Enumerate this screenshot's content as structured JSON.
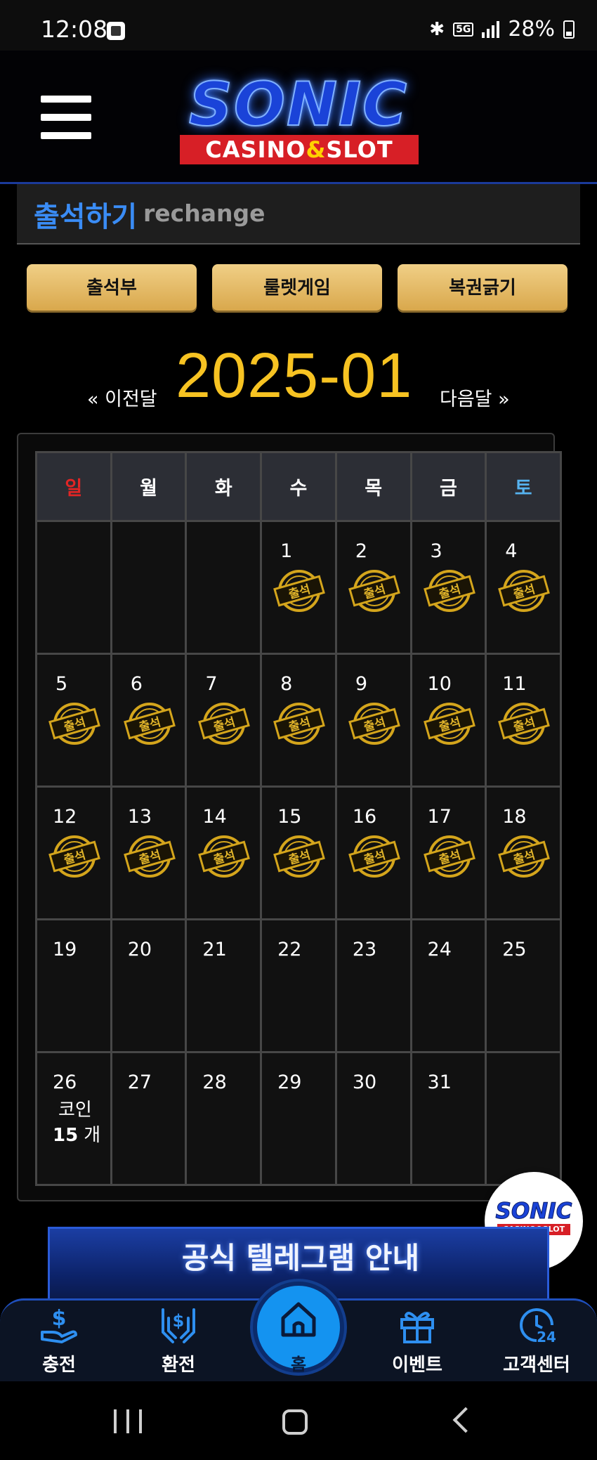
{
  "status_bar": {
    "time": "12:08",
    "network": "5G",
    "battery": "28%"
  },
  "header": {
    "logo_main": "SONIC",
    "logo_sub_left": "CASINO",
    "logo_amp": "&",
    "logo_sub_right": "SLOT"
  },
  "title": {
    "ko": "출석하기",
    "en": "rechange"
  },
  "buttons": {
    "attendance": "출석부",
    "roulette": "룰렛게임",
    "lottery": "복권긁기"
  },
  "calendar": {
    "prev_label": "« 이전달",
    "next_label": "다음달 »",
    "month": "2025-01",
    "weekdays": [
      "일",
      "월",
      "화",
      "수",
      "목",
      "금",
      "토"
    ],
    "stamp_label": "출석",
    "weeks": [
      [
        null,
        null,
        null,
        {
          "day": "1",
          "stamp": true
        },
        {
          "day": "2",
          "stamp": true
        },
        {
          "day": "3",
          "stamp": true
        },
        {
          "day": "4",
          "stamp": true
        }
      ],
      [
        {
          "day": "5",
          "stamp": true
        },
        {
          "day": "6",
          "stamp": true
        },
        {
          "day": "7",
          "stamp": true
        },
        {
          "day": "8",
          "stamp": true
        },
        {
          "day": "9",
          "stamp": true
        },
        {
          "day": "10",
          "stamp": true
        },
        {
          "day": "11",
          "stamp": true
        }
      ],
      [
        {
          "day": "12",
          "stamp": true
        },
        {
          "day": "13",
          "stamp": true
        },
        {
          "day": "14",
          "stamp": true
        },
        {
          "day": "15",
          "stamp": true
        },
        {
          "day": "16",
          "stamp": true
        },
        {
          "day": "17",
          "stamp": true
        },
        {
          "day": "18",
          "stamp": true
        }
      ],
      [
        {
          "day": "19"
        },
        {
          "day": "20"
        },
        {
          "day": "21"
        },
        {
          "day": "22"
        },
        {
          "day": "23"
        },
        {
          "day": "24"
        },
        {
          "day": "25"
        }
      ],
      [
        {
          "day": "26",
          "coin_label": "코인",
          "coin_count": "15",
          "coin_unit": "개"
        },
        {
          "day": "27"
        },
        {
          "day": "28"
        },
        {
          "day": "29"
        },
        {
          "day": "30"
        },
        {
          "day": "31"
        },
        null
      ]
    ]
  },
  "floating_logo": {
    "main": "SONIC",
    "sub": "CASINO&SLOT"
  },
  "banner": {
    "text": "공식 텔레그램 안내"
  },
  "bottom_nav": {
    "deposit": "충전",
    "withdraw": "환전",
    "home": "홈",
    "event": "이벤트",
    "support": "고객센터"
  },
  "colors": {
    "accent_blue": "#3a8cf5",
    "gold": "#f7c322",
    "sunday": "#e22525",
    "saturday": "#56b3f0",
    "button_gold": "#e8c274"
  }
}
